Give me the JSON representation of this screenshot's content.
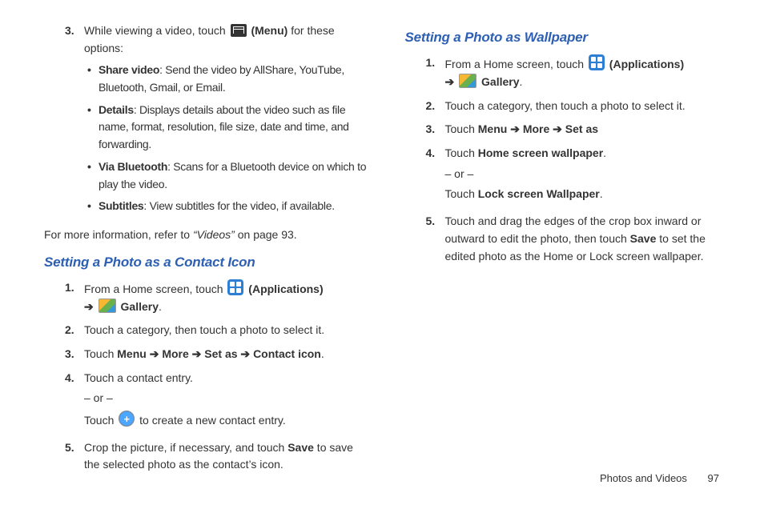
{
  "left": {
    "item3": {
      "num": "3.",
      "pre": "While viewing a video, touch ",
      "icon": "menu-icon",
      "menuLabel": "(Menu)",
      "post": " for these options:",
      "bullets": [
        {
          "bold": "Share video",
          "rest": ": Send the video by AllShare, YouTube, Bluetooth, Gmail, or Email."
        },
        {
          "bold": "Details",
          "rest": ": Displays details about the video such as file name, format, resolution, file size, date and time, and forwarding."
        },
        {
          "bold": "Via Bluetooth",
          "rest": ": Scans for a Bluetooth device on which to play the video."
        },
        {
          "bold": "Subtitles",
          "rest": ": View subtitles for the video, if available."
        }
      ]
    },
    "ref": {
      "pre": "For more information, refer to ",
      "ital": "“Videos”",
      "post": "  on page 93."
    },
    "heading": "Setting a Photo as a Contact Icon",
    "steps": {
      "s1": {
        "num": "1.",
        "pre": "From a Home screen, touch ",
        "appsLabel": "(Applications)",
        "arrow": "➔",
        "galleryLabel": "Gallery",
        "dot": "."
      },
      "s2": {
        "num": "2.",
        "text": "Touch a category, then touch a photo to select it."
      },
      "s3": {
        "num": "3.",
        "pre": "Touch ",
        "b1": "Menu",
        "a1": " ➔ ",
        "b2": "More",
        "a2": " ➔ ",
        "b3": "Set as",
        "a3": " ➔ ",
        "b4": "Contact icon",
        "dot": "."
      },
      "s4": {
        "num": "4.",
        "l1": "Touch a contact entry.",
        "or": "– or –",
        "l2pre": "Touch ",
        "l2post": " to create a new contact entry."
      },
      "s5": {
        "num": "5.",
        "pre": "Crop the picture, if necessary, and touch ",
        "b": "Save",
        "post": " to save the selected photo as the contact’s icon."
      }
    }
  },
  "right": {
    "heading": "Setting a Photo as Wallpaper",
    "steps": {
      "s1": {
        "num": "1.",
        "pre": "From a Home screen, touch ",
        "appsLabel": "(Applications)",
        "arrow": "➔",
        "galleryLabel": "Gallery",
        "dot": "."
      },
      "s2": {
        "num": "2.",
        "text": "Touch a category, then touch a photo to select it."
      },
      "s3": {
        "num": "3.",
        "pre": "Touch ",
        "b1": "Menu",
        "a1": " ➔ ",
        "b2": "More",
        "a2": " ➔ ",
        "b3": "Set as"
      },
      "s4": {
        "num": "4.",
        "pre": "Touch ",
        "b": "Home screen wallpaper",
        "dot": ".",
        "or": "– or –",
        "l2pre": "Touch ",
        "b2": "Lock screen Wallpaper",
        "dot2": "."
      },
      "s5": {
        "num": "5.",
        "pre": "Touch and drag the edges of the crop box inward or outward to edit the photo, then touch ",
        "b": "Save",
        "post": " to set the edited photo as the Home or Lock screen wallpaper."
      }
    }
  },
  "footer": {
    "section": "Photos and Videos",
    "page": "97"
  }
}
